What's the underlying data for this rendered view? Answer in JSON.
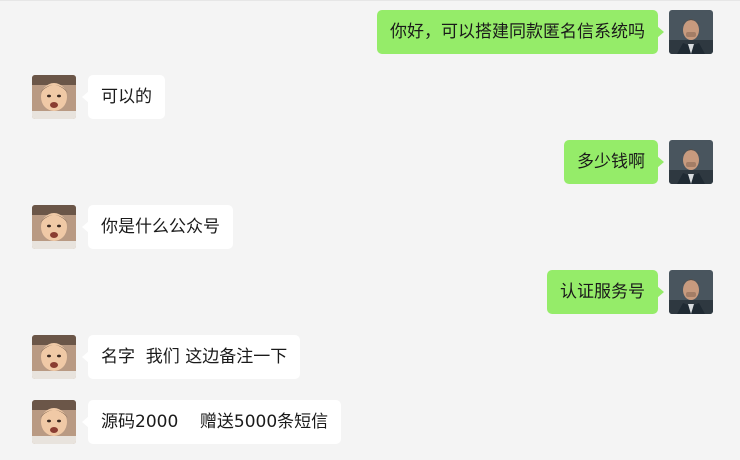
{
  "colors": {
    "background": "#f4f4f4",
    "my_bubble": "#95ec69",
    "their_bubble": "#ffffff",
    "text": "#1a1a1a"
  },
  "messages": [
    {
      "sender": "me",
      "text": "你好，可以搭建同款匿名信系统吗",
      "avatar_icon": "man-portrait-avatar"
    },
    {
      "sender": "them",
      "text": "可以的",
      "avatar_icon": "child-photo-avatar"
    },
    {
      "sender": "me",
      "text": "多少钱啊",
      "avatar_icon": "man-portrait-avatar"
    },
    {
      "sender": "them",
      "text": "你是什么公众号",
      "avatar_icon": "child-photo-avatar"
    },
    {
      "sender": "me",
      "text": "认证服务号",
      "avatar_icon": "man-portrait-avatar"
    },
    {
      "sender": "them",
      "text": "名字  我们 这边备注一下",
      "avatar_icon": "child-photo-avatar"
    },
    {
      "sender": "them",
      "text": "源码2000    赠送5000条短信",
      "avatar_icon": "child-photo-avatar"
    }
  ]
}
